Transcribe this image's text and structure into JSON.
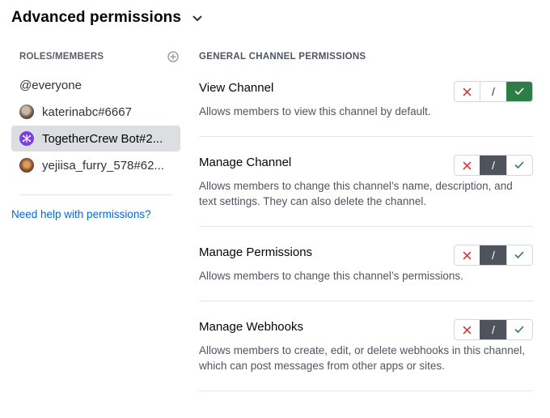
{
  "header": {
    "title": "Advanced permissions"
  },
  "sidebar": {
    "heading": "ROLES/MEMBERS",
    "members": [
      {
        "name": "@everyone",
        "avatar": "none"
      },
      {
        "name": "katerinabc#6667",
        "avatar": "photo-avatar"
      },
      {
        "name": "TogetherCrew Bot#2...",
        "avatar": "bot-avatar",
        "selected": true
      },
      {
        "name": "yejiisa_furry_578#62...",
        "avatar": "photo-avatar"
      }
    ],
    "help_link": "Need help with permissions?"
  },
  "main": {
    "section_title": "GENERAL CHANNEL PERMISSIONS",
    "permissions": [
      {
        "name": "View Channel",
        "description": "Allows members to view this channel by default.",
        "state": "allow"
      },
      {
        "name": "Manage Channel",
        "description": "Allows members to change this channel’s name, description, and text settings. They can also delete the channel.",
        "state": "neutral"
      },
      {
        "name": "Manage Permissions",
        "description": "Allows members to change this channel’s permissions.",
        "state": "neutral"
      },
      {
        "name": "Manage Webhooks",
        "description": "Allows members to create, edit, or delete webhooks in this channel, which can post messages from other apps or sites.",
        "state": "neutral"
      }
    ],
    "toggle_neutral_label": "/"
  },
  "colors": {
    "allow": "#2d7d46",
    "deny": "#d83c3e",
    "neutral_active": "#4f545c",
    "link": "#0068e0",
    "selected_row": "#dcdee1"
  }
}
